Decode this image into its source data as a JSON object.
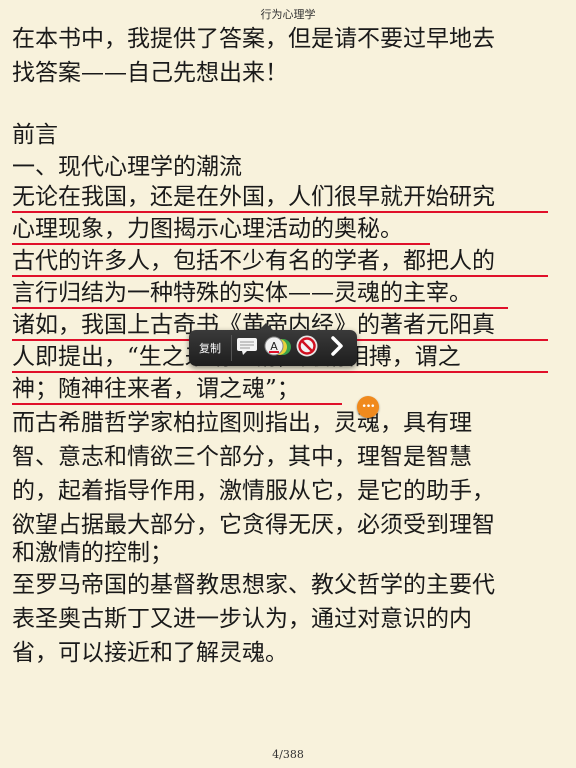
{
  "header": {
    "title": "行为心理学"
  },
  "content": {
    "lines": [
      "在本书中，我提供了答案，但是请不要过早地去",
      "找答案——自己先想出来！",
      "",
      "前言",
      "一、现代心理学的潮流",
      "无论在我国，还是在外国，人们很早就开始研究",
      "心理现象，力图揭示心理活动的奥秘。",
      "古代的许多人，包括不少有名的学者，都把人的",
      "言行归结为一种特殊的实体——灵魂的主宰。",
      "诸如，我国上古奇书《黄帝内经》的著者元阳真",
      "人即提出，“生之来谓之精，两精相搏，谓之",
      "神；随神往来者，谓之魂”；",
      "而古希腊哲学家柏拉图则指出，灵魂，具有理",
      "智、意志和情欲三个部分，其中，理智是智慧",
      "的，起着指导作用，激情服从它，是它的助手，",
      "欲望占据最大部分，它贪得无厌，必须受到理智",
      "和激情的控制；",
      "至罗马帝国的基督教思想家、教父哲学的主要代",
      "表圣奥古斯丁又进一步认为，通过对意识的内",
      "省，可以接近和了解灵魂。"
    ]
  },
  "popup": {
    "copy_label": "复制",
    "icons": [
      "note-icon",
      "highlight-colors-icon",
      "remove-highlight-icon",
      "next-arrow-icon"
    ]
  },
  "note_bubble": {
    "glyph": "•••"
  },
  "footer": {
    "page_indicator": "4/388"
  },
  "colors": {
    "background": "#f8f2dc",
    "highlight_underline": "#e0102a",
    "note_bubble": "#f08a1d"
  }
}
